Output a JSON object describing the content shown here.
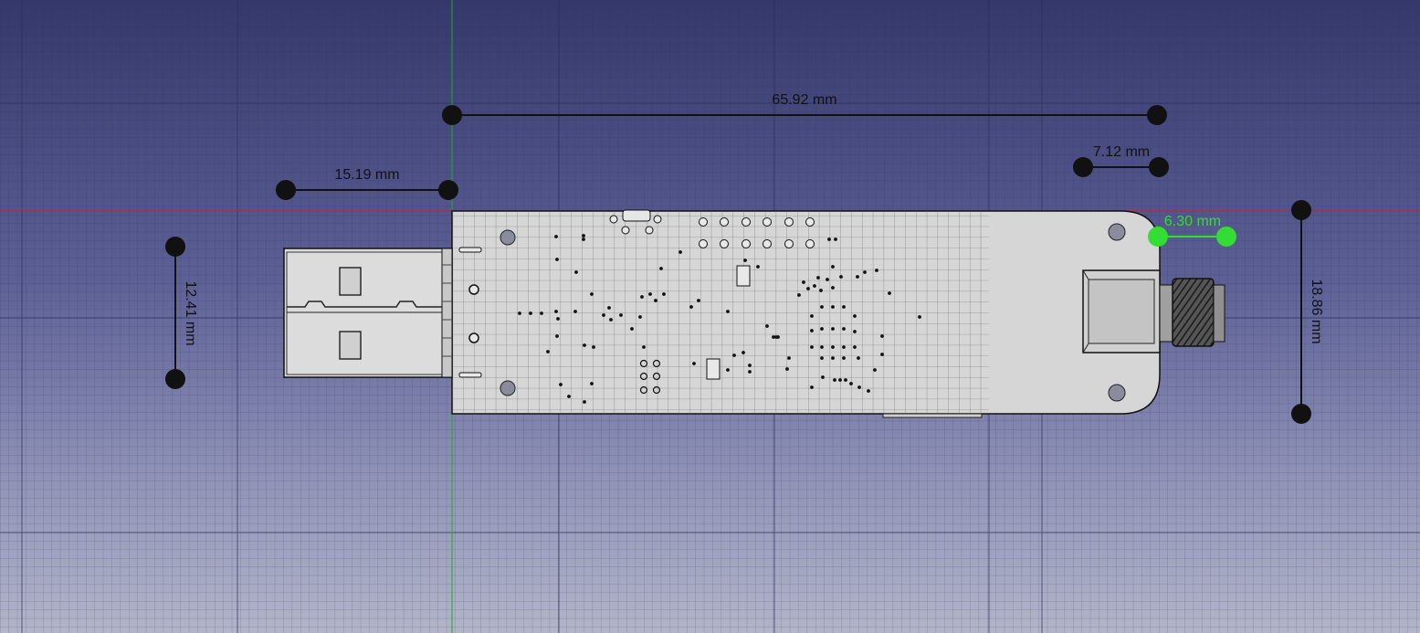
{
  "viewer": {
    "background_top": "#34386b",
    "background_bottom": "#b2b4c9",
    "grid_color": "#2b2f5a",
    "axis_x_color": "#cc2222",
    "axis_y_color": "#22aa22",
    "selected_color": "#33dd33",
    "dimension_color": "#111111"
  },
  "model": {
    "name_icon": "pcb-board-icon",
    "parts": [
      "usb-connector",
      "pcb",
      "sma-connector"
    ]
  },
  "dimensions": {
    "total_length": "65.92 mm",
    "usb_length": "15.19 mm",
    "usb_height": "12.41 mm",
    "sma_offset": "7.12 mm",
    "hole_spacing": "6.30 mm",
    "board_height": "18.86 mm"
  }
}
